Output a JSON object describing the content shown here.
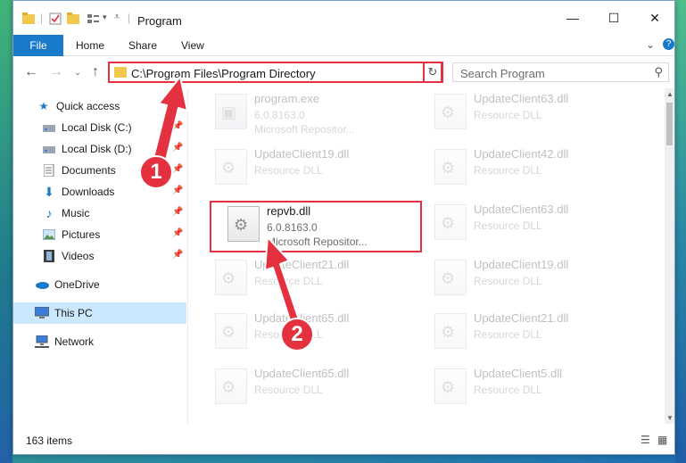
{
  "titlebar": {
    "title": "Program",
    "minimize": "—",
    "maximize": "☐",
    "close": "✕"
  },
  "ribbon": {
    "tabs": [
      "File",
      "Home",
      "Share",
      "View"
    ],
    "collapse": "⌄",
    "help": "?"
  },
  "address": {
    "path": "C:\\Program Files\\Program Directory",
    "search_placeholder": "Search Program"
  },
  "sidebar": {
    "items": [
      {
        "label": "Quick access",
        "icon": "star-icon",
        "pinned": false
      },
      {
        "label": "Local Disk (C:)",
        "icon": "drive-icon",
        "pinned": true
      },
      {
        "label": "Local Disk (D:)",
        "icon": "drive-icon",
        "pinned": true
      },
      {
        "label": "Documents",
        "icon": "documents-icon",
        "pinned": true
      },
      {
        "label": "Downloads",
        "icon": "download-icon",
        "pinned": true
      },
      {
        "label": "Music",
        "icon": "music-icon",
        "pinned": true
      },
      {
        "label": "Pictures",
        "icon": "pictures-icon",
        "pinned": true
      },
      {
        "label": "Videos",
        "icon": "videos-icon",
        "pinned": true
      },
      {
        "label": "OneDrive",
        "icon": "cloud-icon",
        "pinned": false
      },
      {
        "label": "This PC",
        "icon": "computer-icon",
        "pinned": false
      },
      {
        "label": "Network",
        "icon": "network-icon",
        "pinned": false
      }
    ]
  },
  "files": [
    {
      "name": "program.exe",
      "meta1": "6.0.8163.0",
      "meta2": "Microsoft Repositor...",
      "kind": "exe",
      "faded": true
    },
    {
      "name": "UpdateClient63.dll",
      "meta1": "Resource DLL",
      "meta2": "",
      "kind": "dll",
      "faded": true
    },
    {
      "name": "UpdateClient19.dll",
      "meta1": "Resource DLL",
      "meta2": "",
      "kind": "dll",
      "faded": true
    },
    {
      "name": "UpdateClient42.dll",
      "meta1": "Resource DLL",
      "meta2": "",
      "kind": "dll",
      "faded": true
    },
    {
      "name": "repvb.dll",
      "meta1": "6.0.8163.0",
      "meta2": "Microsoft Repositor...",
      "kind": "dll",
      "faded": false
    },
    {
      "name": "UpdateClient63.dll",
      "meta1": "Resource DLL",
      "meta2": "",
      "kind": "dll",
      "faded": true
    },
    {
      "name": "UpdateClient21.dll",
      "meta1": "Resource DLL",
      "meta2": "",
      "kind": "dll",
      "faded": true
    },
    {
      "name": "UpdateClient19.dll",
      "meta1": "Resource DLL",
      "meta2": "",
      "kind": "dll",
      "faded": true
    },
    {
      "name": "UpdateClient65.dll",
      "meta1": "Resource DLL",
      "meta2": "",
      "kind": "dll",
      "faded": true
    },
    {
      "name": "UpdateClient21.dll",
      "meta1": "Resource DLL",
      "meta2": "",
      "kind": "dll",
      "faded": true
    },
    {
      "name": "UpdateClient65.dll",
      "meta1": "Resource DLL",
      "meta2": "",
      "kind": "dll",
      "faded": true
    },
    {
      "name": "UpdateClient5.dll",
      "meta1": "Resource DLL",
      "meta2": "",
      "kind": "dll",
      "faded": true
    }
  ],
  "status": {
    "count": "163 items"
  },
  "annotations": {
    "step1": "1",
    "step2": "2",
    "color": "#e4313f"
  }
}
